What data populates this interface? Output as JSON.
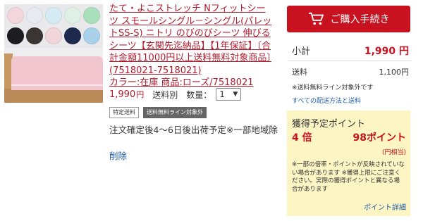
{
  "product": {
    "title": "たて・よこストレッチ Nフィットシーツ スモールシングル－シングル(パレットSS-S) ニトリ のびのびシーツ 伸びるシーツ【玄関先迄納品】【1年保証】〔合計金額11000円以上送料無料対象商品〕(7518021-7518021)",
    "color_line": "カラー:在庫 商品:ローズ/7518021",
    "price": "1,990",
    "price_unit": "円",
    "tax_label": "送料別",
    "quantity_label": "数量：",
    "quantity_value": "1",
    "tags": [
      "特定送料",
      "送料無料ライン対象外"
    ],
    "shipping_note": "注文確定後4～6日後出荷予定※一部地域除",
    "delete_label": "削除",
    "swatch_colors_row1": [
      "#f3d6dc",
      "#e8eaf2",
      "#d6ecf4",
      "#dff1e6",
      "#a9dfbb"
    ],
    "swatch_colors_row2": [
      "#1d1d1f",
      "#3a3433",
      "#f0d6da",
      "#1e2a4d",
      "#a9d2ea"
    ],
    "mattress_color": "#f2c6cf"
  },
  "summary": {
    "cart_button_label": "ご購入手続き",
    "cart_button_color": "#c8121f",
    "subtotal_label": "小計",
    "subtotal_value": "1,990 円",
    "shipping_label": "送料",
    "shipping_value": "1,100円",
    "free_ship_note": "※送料無料ライン対象外です",
    "shipping_link": "すべての配送方法と送料"
  },
  "points": {
    "title": "獲得予定ポイント",
    "multiplier": "4 倍",
    "amount": "98ポイント",
    "equivalent": "(円相当)",
    "notes": "※一部の倍率・ポイントが反映されていない場合があります ※獲得上限にご注意ください。実際の獲得ポイントと異なる場合があります",
    "detail_link": "ポイント詳細",
    "box_color": "#fdf5c4"
  }
}
